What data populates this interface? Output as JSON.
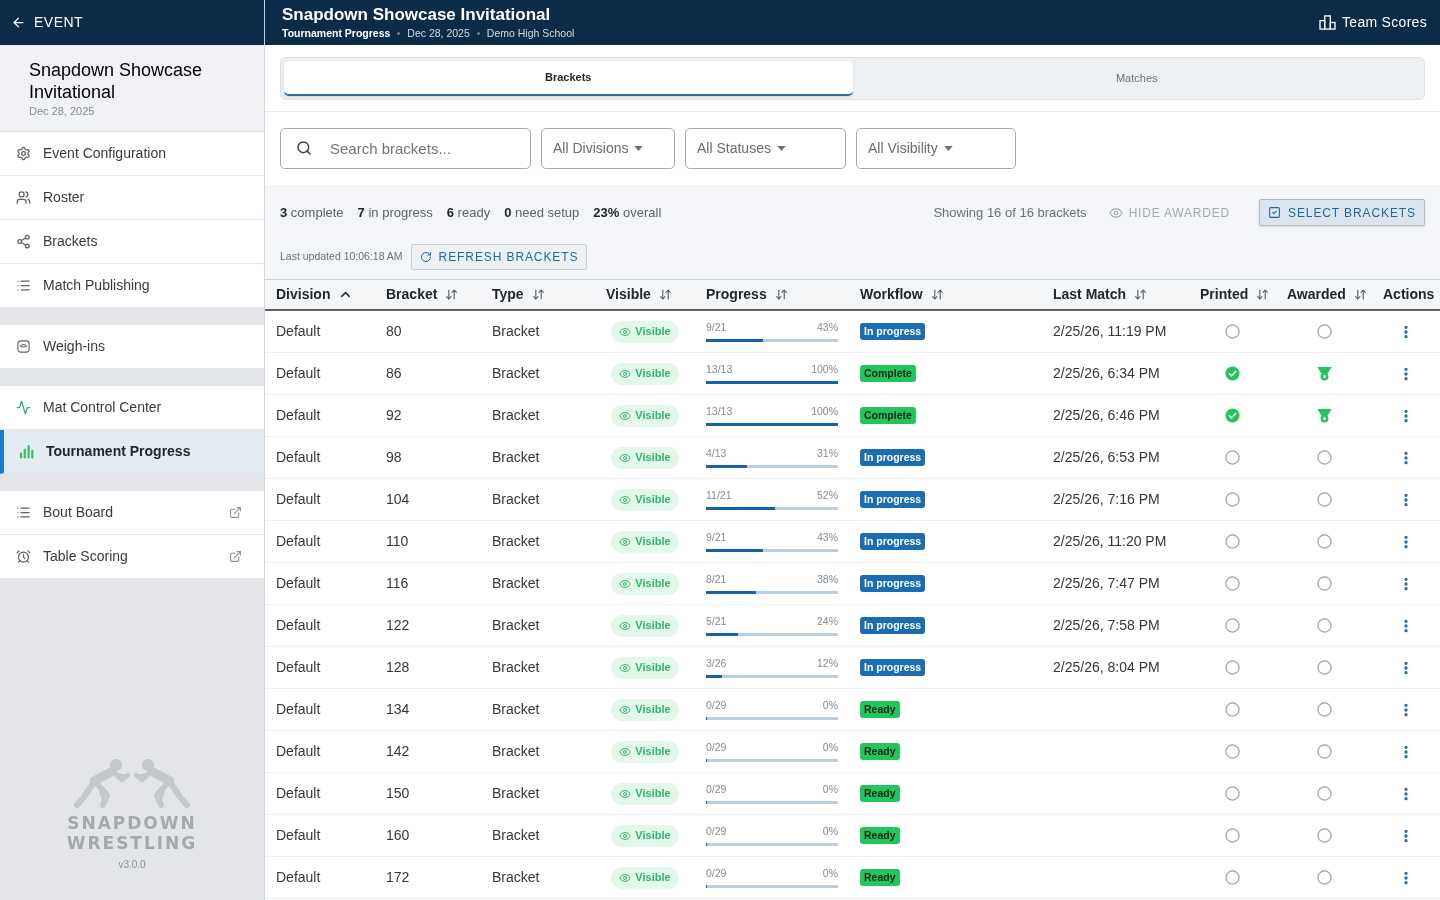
{
  "sidebar": {
    "back": {
      "label": "EVENT"
    },
    "event": {
      "title": "Snapdown Showcase Invitational",
      "date": "Dec 28, 2025"
    },
    "groups": [
      [
        {
          "label": "Event Configuration",
          "selected": false,
          "external": false
        },
        {
          "label": "Roster",
          "selected": false,
          "external": false
        },
        {
          "label": "Brackets",
          "selected": false,
          "external": false
        },
        {
          "label": "Match Publishing",
          "selected": false,
          "external": false
        }
      ],
      [
        {
          "label": "Weigh-ins",
          "selected": false,
          "external": false
        }
      ],
      [
        {
          "label": "Mat Control Center",
          "selected": false,
          "external": false
        },
        {
          "label": "Tournament Progress",
          "selected": true,
          "external": false
        }
      ],
      [
        {
          "label": "Bout Board",
          "selected": false,
          "external": true
        },
        {
          "label": "Table Scoring",
          "selected": false,
          "external": true
        }
      ]
    ],
    "logo": {
      "lines": [
        "SNAPDOWN",
        "WRESTLING"
      ],
      "version": "v3.0.0"
    }
  },
  "header": {
    "title": "Snapdown Showcase Invitational",
    "meta": [
      "Tournament Progress",
      "Dec 28, 2025",
      "Demo High School"
    ],
    "action": "Team Scores"
  },
  "tabs": [
    {
      "label": "Brackets",
      "selected": true
    },
    {
      "label": "Matches",
      "selected": false
    }
  ],
  "filters": {
    "search": {
      "placeholder": "Search brackets..."
    },
    "dropdowns": [
      "All Divisions",
      "All Statuses",
      "All Visibility"
    ]
  },
  "summary": {
    "stats": [
      "**3** complete",
      "**7** in progress",
      "**6** ready",
      "**0** need setup",
      "**23%** overall"
    ],
    "showing": "Showing 16 of 16 brackets",
    "hide_awarded": {
      "label": "HIDE AWARDED",
      "active": false
    },
    "select_button": "SELECT BRACKETS",
    "last_updated": "Last updated 10:06:18 AM",
    "refresh_button": "REFRESH BRACKETS"
  },
  "table": {
    "columns": [
      {
        "label": "Division",
        "sortable": true,
        "sorted": true
      },
      {
        "label": "Bracket",
        "sortable": true,
        "sorted": false
      },
      {
        "label": "Type",
        "sortable": true,
        "sorted": false
      },
      {
        "label": "Visible",
        "sortable": true,
        "sorted": false
      },
      {
        "label": "Progress",
        "sortable": true,
        "sorted": false
      },
      {
        "label": "Workflow",
        "sortable": true,
        "sorted": false
      },
      {
        "label": "Last Match",
        "sortable": true,
        "sorted": false
      },
      {
        "label": "Printed",
        "sortable": true,
        "sorted": false
      },
      {
        "label": "Awarded",
        "sortable": true,
        "sorted": false
      },
      {
        "label": "Actions",
        "sortable": false
      }
    ],
    "rows": [
      {
        "division": "Default",
        "bracket": "80",
        "type": "Bracket",
        "visible": {
          "label": "Visible",
          "on": true
        },
        "progress": {
          "count": "9/21",
          "percent": "43%",
          "level": 0.43
        },
        "workflow": {
          "label": "In progress",
          "kind": "in_progress"
        },
        "last_match": "2/25/26, 11:19 PM",
        "printed": false,
        "awarded": false
      },
      {
        "division": "Default",
        "bracket": "86",
        "type": "Bracket",
        "visible": {
          "label": "Visible",
          "on": true
        },
        "progress": {
          "count": "13/13",
          "percent": "100%",
          "level": 1
        },
        "workflow": {
          "label": "Complete",
          "kind": "complete"
        },
        "last_match": "2/25/26, 6:34 PM",
        "printed": true,
        "awarded": true
      },
      {
        "division": "Default",
        "bracket": "92",
        "type": "Bracket",
        "visible": {
          "label": "Visible",
          "on": true
        },
        "progress": {
          "count": "13/13",
          "percent": "100%",
          "level": 1
        },
        "workflow": {
          "label": "Complete",
          "kind": "complete"
        },
        "last_match": "2/25/26, 6:46 PM",
        "printed": true,
        "awarded": true
      },
      {
        "division": "Default",
        "bracket": "98",
        "type": "Bracket",
        "visible": {
          "label": "Visible",
          "on": true
        },
        "progress": {
          "count": "4/13",
          "percent": "31%",
          "level": 0.31
        },
        "workflow": {
          "label": "In progress",
          "kind": "in_progress"
        },
        "last_match": "2/25/26, 6:53 PM",
        "printed": false,
        "awarded": false
      },
      {
        "division": "Default",
        "bracket": "104",
        "type": "Bracket",
        "visible": {
          "label": "Visible",
          "on": true
        },
        "progress": {
          "count": "11/21",
          "percent": "52%",
          "level": 0.52
        },
        "workflow": {
          "label": "In progress",
          "kind": "in_progress"
        },
        "last_match": "2/25/26, 7:16 PM",
        "printed": false,
        "awarded": false
      },
      {
        "division": "Default",
        "bracket": "110",
        "type": "Bracket",
        "visible": {
          "label": "Visible",
          "on": true
        },
        "progress": {
          "count": "9/21",
          "percent": "43%",
          "level": 0.43
        },
        "workflow": {
          "label": "In progress",
          "kind": "in_progress"
        },
        "last_match": "2/25/26, 11:20 PM",
        "printed": false,
        "awarded": false
      },
      {
        "division": "Default",
        "bracket": "116",
        "type": "Bracket",
        "visible": {
          "label": "Visible",
          "on": true
        },
        "progress": {
          "count": "8/21",
          "percent": "38%",
          "level": 0.38
        },
        "workflow": {
          "label": "In progress",
          "kind": "in_progress"
        },
        "last_match": "2/25/26, 7:47 PM",
        "printed": false,
        "awarded": false
      },
      {
        "division": "Default",
        "bracket": "122",
        "type": "Bracket",
        "visible": {
          "label": "Visible",
          "on": true
        },
        "progress": {
          "count": "5/21",
          "percent": "24%",
          "level": 0.24
        },
        "workflow": {
          "label": "In progress",
          "kind": "in_progress"
        },
        "last_match": "2/25/26, 7:58 PM",
        "printed": false,
        "awarded": false
      },
      {
        "division": "Default",
        "bracket": "128",
        "type": "Bracket",
        "visible": {
          "label": "Visible",
          "on": true
        },
        "progress": {
          "count": "3/26",
          "percent": "12%",
          "level": 0.12
        },
        "workflow": {
          "label": "In progress",
          "kind": "in_progress"
        },
        "last_match": "2/25/26, 8:04 PM",
        "printed": false,
        "awarded": false
      },
      {
        "division": "Default",
        "bracket": "134",
        "type": "Bracket",
        "visible": {
          "label": "Visible",
          "on": true
        },
        "progress": {
          "count": "0/29",
          "percent": "0%",
          "level": 0
        },
        "workflow": {
          "label": "Ready",
          "kind": "ready"
        },
        "printed": false,
        "awarded": false
      },
      {
        "division": "Default",
        "bracket": "142",
        "type": "Bracket",
        "visible": {
          "label": "Visible",
          "on": true
        },
        "progress": {
          "count": "0/29",
          "percent": "0%",
          "level": 0
        },
        "workflow": {
          "label": "Ready",
          "kind": "ready"
        },
        "printed": false,
        "awarded": false
      },
      {
        "division": "Default",
        "bracket": "150",
        "type": "Bracket",
        "visible": {
          "label": "Visible",
          "on": true
        },
        "progress": {
          "count": "0/29",
          "percent": "0%",
          "level": 0
        },
        "workflow": {
          "label": "Ready",
          "kind": "ready"
        },
        "printed": false,
        "awarded": false
      },
      {
        "division": "Default",
        "bracket": "160",
        "type": "Bracket",
        "visible": {
          "label": "Visible",
          "on": true
        },
        "progress": {
          "count": "0/29",
          "percent": "0%",
          "level": 0
        },
        "workflow": {
          "label": "Ready",
          "kind": "ready"
        },
        "printed": false,
        "awarded": false
      },
      {
        "division": "Default",
        "bracket": "172",
        "type": "Bracket",
        "visible": {
          "label": "Visible",
          "on": true
        },
        "progress": {
          "count": "0/29",
          "percent": "0%",
          "level": 0
        },
        "workflow": {
          "label": "Ready",
          "kind": "ready"
        },
        "printed": false,
        "awarded": false
      }
    ]
  }
}
